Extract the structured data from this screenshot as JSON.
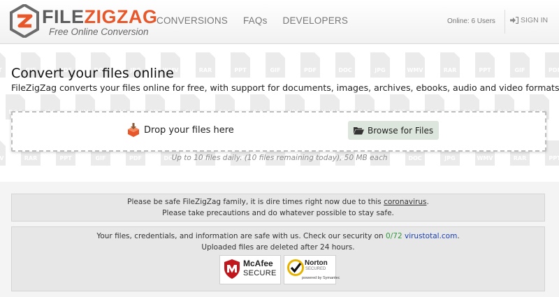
{
  "brand": {
    "name_part1": "FILE",
    "name_part2": "ZIGZAG",
    "tagline": "Free Online Conversion",
    "accent": "#e8572a",
    "dark": "#5b5b5b"
  },
  "nav": {
    "items": [
      {
        "label": "CONVERSIONS"
      },
      {
        "label": "FAQs"
      },
      {
        "label": "DEVELOPERS"
      }
    ]
  },
  "header": {
    "online": "Online: 6 Users",
    "signin": "SIGN IN"
  },
  "hero": {
    "title": "Convert your files online",
    "description": "FileZigZag converts your files online for free, with support for documents, images, archives, ebooks, audio and video formats.",
    "drop_label": "Drop your files here",
    "browse_label": "Browse for Files",
    "limit": "Up to 10 files daily. (10 files remaining today), 50 MB each",
    "bg_file_types": [
      "PPT",
      "GIF",
      "PDF",
      "DOC",
      "JPG",
      "WMV",
      "RAR"
    ]
  },
  "notice1": {
    "line1_pre": "Please be safe FileZigZag family, it is dire times right now due to this ",
    "line1_link": "coronavirus",
    "line1_post": ".",
    "line2": "Please take precautions and do whatever possible to stay safe."
  },
  "notice2": {
    "line1_pre": "Your files, credentials, and information are safe with us. Check our security on ",
    "score": "0/72",
    "site": "virustotal.com",
    "line1_post": ".",
    "line2": "Uploaded files are deleted after 24 hours."
  },
  "badges": {
    "mcafee_line1": "McAfee",
    "mcafee_line2": "SECURE",
    "norton_line1": "Norton",
    "norton_line2": "SECURED",
    "norton_line3": "powered by Symantec"
  }
}
